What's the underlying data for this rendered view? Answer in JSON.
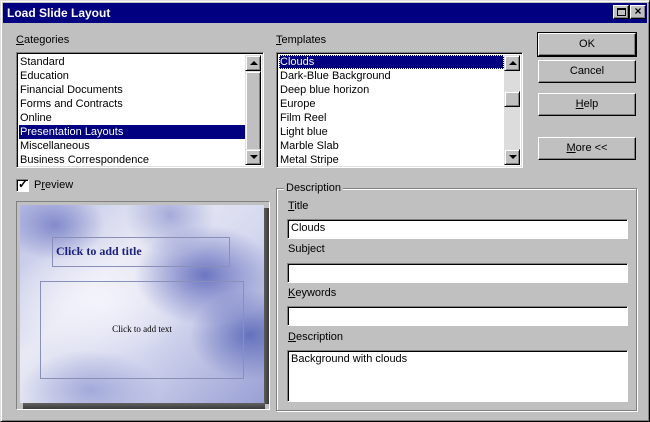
{
  "window": {
    "title": "Load Slide Layout"
  },
  "categories": {
    "label_accel": "C",
    "label_rest": "ategories",
    "items": [
      "Standard",
      "Education",
      "Financial Documents",
      "Forms and Contracts",
      "Online",
      "Presentation Layouts",
      "Miscellaneous",
      "Business Correspondence"
    ],
    "selected": "Presentation Layouts"
  },
  "templates": {
    "label_accel": "T",
    "label_rest": "emplates",
    "items": [
      "Clouds",
      "Dark-Blue Background",
      "Deep blue horizon",
      "Europe",
      "Film Reel",
      "Light blue",
      "Marble Slab",
      "Metal Stripe"
    ],
    "selected": "Clouds"
  },
  "buttons": {
    "ok": "OK",
    "cancel": "Cancel",
    "help_accel": "H",
    "help_rest": "elp",
    "more_accel": "M",
    "more_rest": "ore <<"
  },
  "preview": {
    "label_pre": "P",
    "label_accel": "r",
    "label_rest": "eview",
    "checked": true,
    "check_glyph": "✓",
    "slide_title": "Click to add title",
    "slide_body": "Click to add text"
  },
  "description_group": {
    "legend": "Description",
    "title_label_accel": "T",
    "title_label_rest": "itle",
    "title_value": "Clouds",
    "subject_label": "Subject",
    "subject_value": "",
    "keywords_label_accel": "K",
    "keywords_label_rest": "eywords",
    "keywords_value": "",
    "description_label_accel": "D",
    "description_label_rest": "escription",
    "description_value": "Background with clouds"
  },
  "icons": {
    "maximize": "maximize-icon",
    "close": "close-icon",
    "close_glyph": "×"
  }
}
